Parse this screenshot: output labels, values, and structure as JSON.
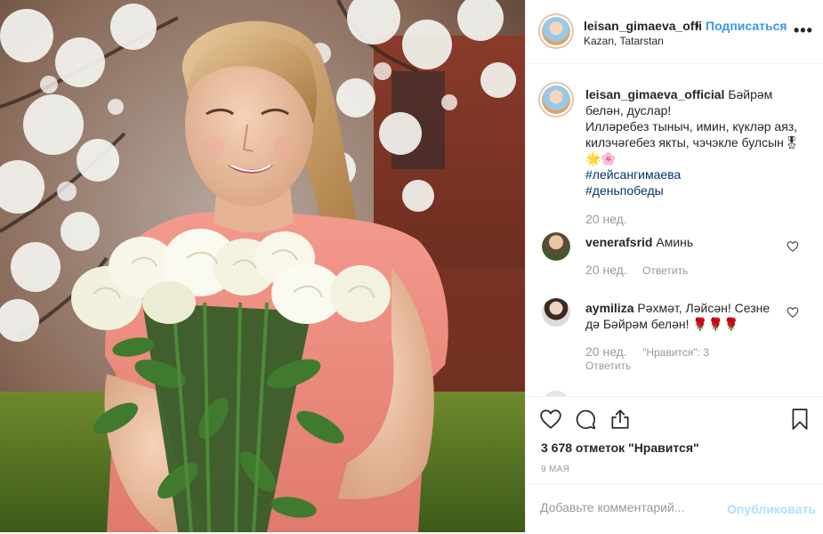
{
  "header": {
    "username": "leisan_gimaeva_offi",
    "separator": "•",
    "follow_label": "Подписаться",
    "location": "Kazan, Tatarstan",
    "more_label": "•••"
  },
  "caption": {
    "username": "leisan_gimaeva_official",
    "lines": [
      "Бәйрәм белән, дуслар!",
      "Илләребез тыныч, имин, күкләр аяз, килэчәгебез якты, чэчэкле булсын🎖",
      "🌟🌸"
    ],
    "hashtags": [
      "#лейсангимаева",
      "#деньпобеды"
    ],
    "time": "20 нед."
  },
  "comments": [
    {
      "username": "venerafsrid",
      "text": "Аминь",
      "time": "20 нед.",
      "reply_label": "Ответить"
    },
    {
      "username": "aymiliza",
      "text": "Рәхмәт, Ләйсән! Сезне дә Бәйрәм белән! 🌹🌹🌹",
      "time": "20 нед.",
      "likes_label": "\"Нравится\": 3",
      "reply_label": "Ответить"
    }
  ],
  "likes_text": "3 678 отметок \"Нравится\"",
  "date": "9 МАЯ",
  "add_comment": {
    "placeholder": "Добавьте комментарий...",
    "publish_label": "Опубликовать"
  },
  "icons": {
    "like": "heart-icon",
    "comment": "comment-icon",
    "share": "share-icon",
    "save": "bookmark-icon",
    "more": "more-icon"
  },
  "colors": {
    "link": "#3897f0",
    "hashtag": "#003569",
    "muted": "#999999",
    "publish_disabled": "#b2dffc"
  }
}
